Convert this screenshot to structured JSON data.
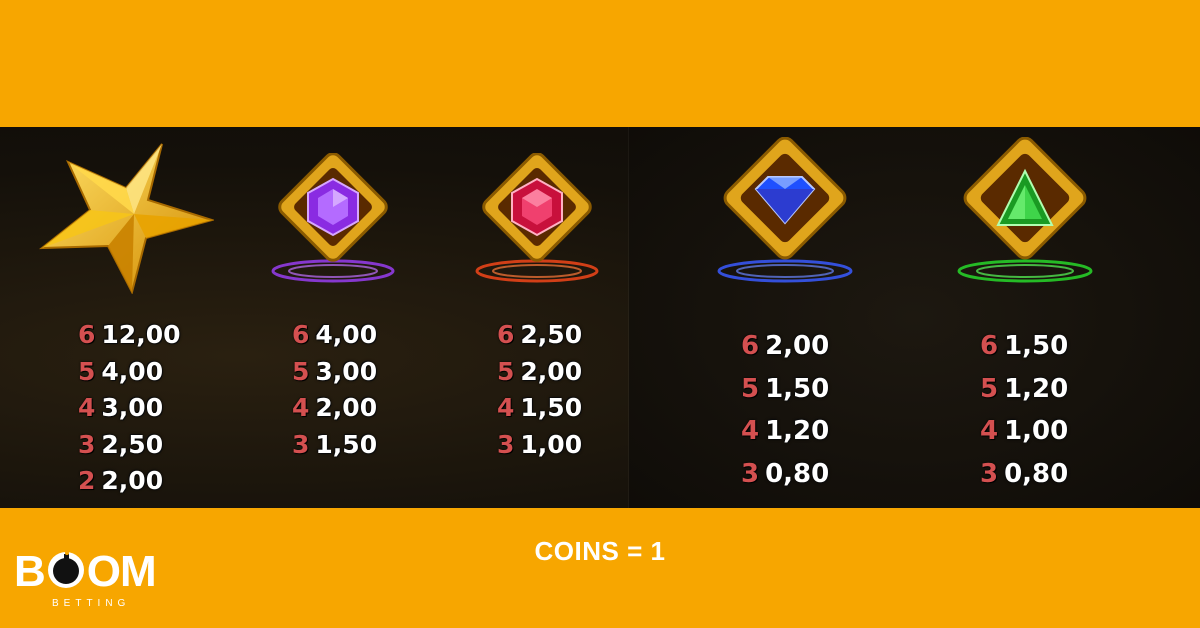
{
  "paytable": {
    "symbols": [
      {
        "id": "star",
        "icon": "gold-star-icon",
        "color": "#f5c518",
        "pays": [
          {
            "count": "6",
            "value": "12,00"
          },
          {
            "count": "5",
            "value": "4,00"
          },
          {
            "count": "4",
            "value": "3,00"
          },
          {
            "count": "3",
            "value": "2,50"
          },
          {
            "count": "2",
            "value": "2,00"
          }
        ]
      },
      {
        "id": "purple",
        "icon": "purple-gem-icon",
        "color": "#8a2be2",
        "pays": [
          {
            "count": "6",
            "value": "4,00"
          },
          {
            "count": "5",
            "value": "3,00"
          },
          {
            "count": "4",
            "value": "2,00"
          },
          {
            "count": "3",
            "value": "1,50"
          }
        ]
      },
      {
        "id": "red",
        "icon": "red-gem-icon",
        "color": "#e0245e",
        "pays": [
          {
            "count": "6",
            "value": "2,50"
          },
          {
            "count": "5",
            "value": "2,00"
          },
          {
            "count": "4",
            "value": "1,50"
          },
          {
            "count": "3",
            "value": "1,00"
          }
        ]
      },
      {
        "id": "blue",
        "icon": "blue-diamond-icon",
        "color": "#1e50ff",
        "pays": [
          {
            "count": "6",
            "value": "2,00"
          },
          {
            "count": "5",
            "value": "1,50"
          },
          {
            "count": "4",
            "value": "1,20"
          },
          {
            "count": "3",
            "value": "0,80"
          }
        ]
      },
      {
        "id": "green",
        "icon": "green-gem-icon",
        "color": "#22c02a",
        "pays": [
          {
            "count": "6",
            "value": "1,50"
          },
          {
            "count": "5",
            "value": "1,20"
          },
          {
            "count": "4",
            "value": "1,00"
          },
          {
            "count": "3",
            "value": "0,80"
          }
        ]
      }
    ]
  },
  "footer": {
    "coins_label": "COINS = 1",
    "logo_text": "BOOM",
    "logo_sub": "BETTING"
  },
  "colors": {
    "background": "#f7a600",
    "count_red": "#d45050",
    "value_white": "#ffffff"
  }
}
